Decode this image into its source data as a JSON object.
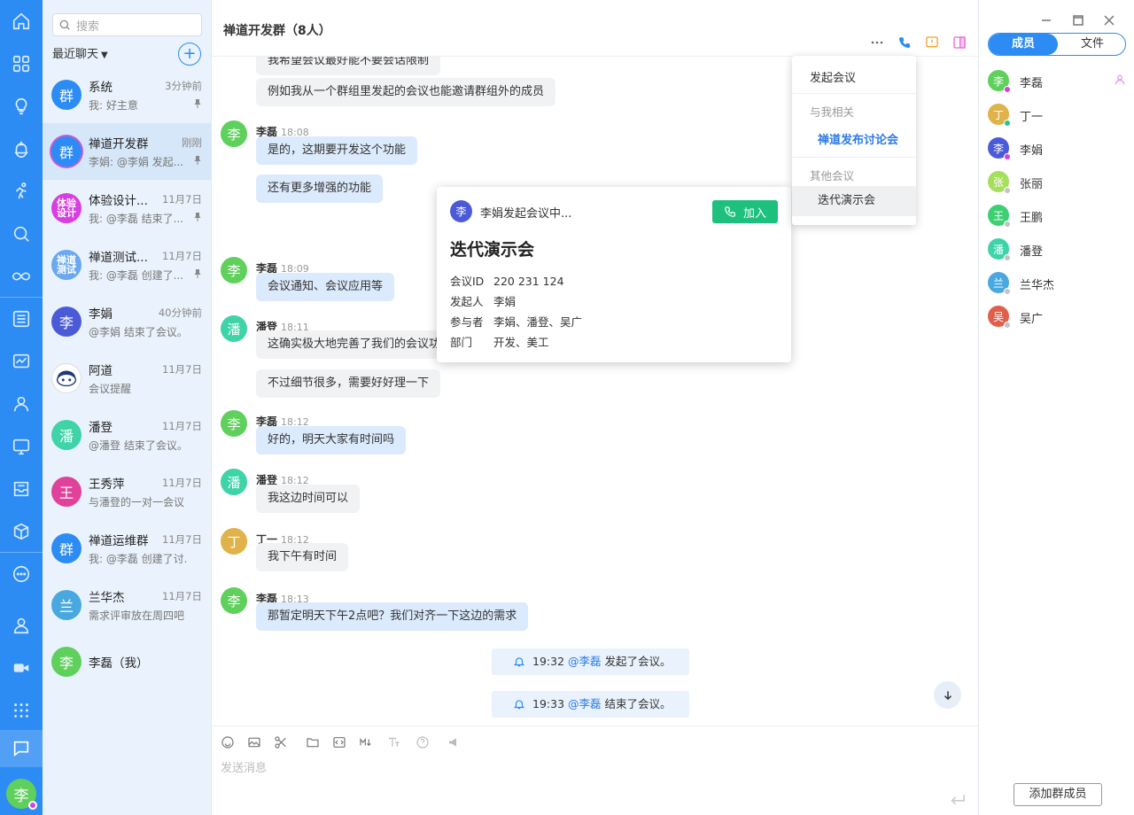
{
  "search": {
    "placeholder": "搜索"
  },
  "list": {
    "recent_label": "最近聊天",
    "add_label": "+",
    "items": [
      {
        "avatar": "群",
        "name": "系统",
        "time": "3分钟前",
        "preview": "我: 好主意",
        "color": "#2c8cf4",
        "pinned": true
      },
      {
        "avatar": "群",
        "name": "禅道开发群",
        "time": "刚刚",
        "preview": "李娟: @李娟 发起...",
        "color": "#2c8cf4",
        "pinned": true
      },
      {
        "avatar": "体验设计",
        "name": "体验设计...",
        "time": "11月7日",
        "preview": "我: @李磊 结束了...",
        "color": "#d93fe0",
        "pinned": true
      },
      {
        "avatar": "禅道测试",
        "name": "禅道测试...",
        "time": "11月7日",
        "preview": "我: @李磊 创建了...",
        "color": "#6aa8f0",
        "pinned": true
      },
      {
        "avatar": "李",
        "name": "李娟",
        "time": "40分钟前",
        "preview": "@李娟 结束了会议。",
        "color": "#4b5bd8"
      },
      {
        "avatar": "",
        "name": "阿道",
        "time": "11月7日",
        "preview": "会议提醒",
        "color": "#ffffff"
      },
      {
        "avatar": "潘",
        "name": "潘登",
        "time": "11月7日",
        "preview": "@潘登 结束了会议。",
        "color": "#3fd3a8"
      },
      {
        "avatar": "王",
        "name": "王秀萍",
        "time": "11月7日",
        "preview": "与潘登的一对一会议",
        "color": "#e0419a"
      },
      {
        "avatar": "群",
        "name": "禅道运维群",
        "time": "11月7日",
        "preview": "我: @李磊 创建了讨...",
        "color": "#2c8cf4"
      },
      {
        "avatar": "兰",
        "name": "兰华杰",
        "time": "11月7日",
        "preview": "需求评审放在周四吧",
        "color": "#4aa8e0"
      },
      {
        "avatar": "李",
        "name": "李磊（我）",
        "time": "",
        "preview": "",
        "color": "#5fd05c"
      }
    ]
  },
  "nav": {
    "me_avatar": "李"
  },
  "chat": {
    "title": "禅道开发群（8人）",
    "messages": [
      {
        "text": "我希望会议最好能不要会话限制"
      },
      {
        "text": "例如我从一个群组里发起的会议也能邀请群组外的成员"
      },
      {
        "sender": "李磊",
        "time": "18:08",
        "avatar": "李",
        "text": "是的，这期要开发这个功能"
      },
      {
        "text": "还有更多增强的功能"
      },
      {
        "sender": "李磊",
        "time": "18:09",
        "avatar": "李",
        "text": "会议通知、会议应用等"
      },
      {
        "sender": "潘登",
        "time": "18:11",
        "avatar": "潘",
        "text": "这确实极大地完善了我们的会议功能"
      },
      {
        "text": "不过细节很多，需要好好理一下"
      },
      {
        "sender": "李磊",
        "time": "18:12",
        "avatar": "李",
        "text": "好的，明天大家有时间吗"
      },
      {
        "sender": "潘登",
        "time": "18:12",
        "avatar": "潘",
        "text": "我这边时间可以"
      },
      {
        "sender": "丁一",
        "time": "18:12",
        "avatar": "丁",
        "text": "我下午有时间"
      },
      {
        "sender": "李磊",
        "time": "18:13",
        "avatar": "李",
        "text": "那暂定明天下午2点吧？我们对齐一下这边的需求"
      }
    ],
    "system": [
      {
        "time": "19:32",
        "at": "@李磊",
        "text": "发起了会议。"
      },
      {
        "time": "19:33",
        "at": "@李磊",
        "text": "结束了会议。"
      }
    ],
    "composer_placeholder": "发送消息"
  },
  "meeting_popup": {
    "avatar": "李",
    "title": "李娟发起会议中...",
    "join_label": "加入",
    "name": "迭代演示会",
    "rows": [
      {
        "k": "会议ID",
        "v": "220 231 124"
      },
      {
        "k": "发起人",
        "v": "李娟"
      },
      {
        "k": "参与者",
        "v": "李娟、潘登、吴广"
      },
      {
        "k": "部门",
        "v": "开发、美工"
      }
    ]
  },
  "meeting_menu": {
    "start": "发起会议",
    "related_header": "与我相关",
    "related_item": "禅道发布讨论会",
    "other_header": "其他会议",
    "other_item": "迭代演示会"
  },
  "members": {
    "tab_members": "成员",
    "tab_files": "文件",
    "list": [
      {
        "avatar": "李",
        "name": "李磊",
        "color": "#5fd05c",
        "status": "purple"
      },
      {
        "avatar": "丁",
        "name": "丁一",
        "color": "#e0b24a",
        "status": "green"
      },
      {
        "avatar": "李",
        "name": "李娟",
        "color": "#4b5bd8",
        "status": "purple"
      },
      {
        "avatar": "张",
        "name": "张丽",
        "color": "#a6de5e",
        "status": "gray"
      },
      {
        "avatar": "王",
        "name": "王鹏",
        "color": "#3ecf73",
        "status": "gray"
      },
      {
        "avatar": "潘",
        "name": "潘登",
        "color": "#3fd3a8",
        "status": "gray"
      },
      {
        "avatar": "兰",
        "name": "兰华杰",
        "color": "#4aa8e0",
        "status": "gray"
      },
      {
        "avatar": "吴",
        "name": "吴广",
        "color": "#e05f4a",
        "status": "gray"
      }
    ],
    "add_label": "添加群成员"
  },
  "colors": {
    "accent": "#2c8cf4",
    "join": "#1dc17d"
  }
}
